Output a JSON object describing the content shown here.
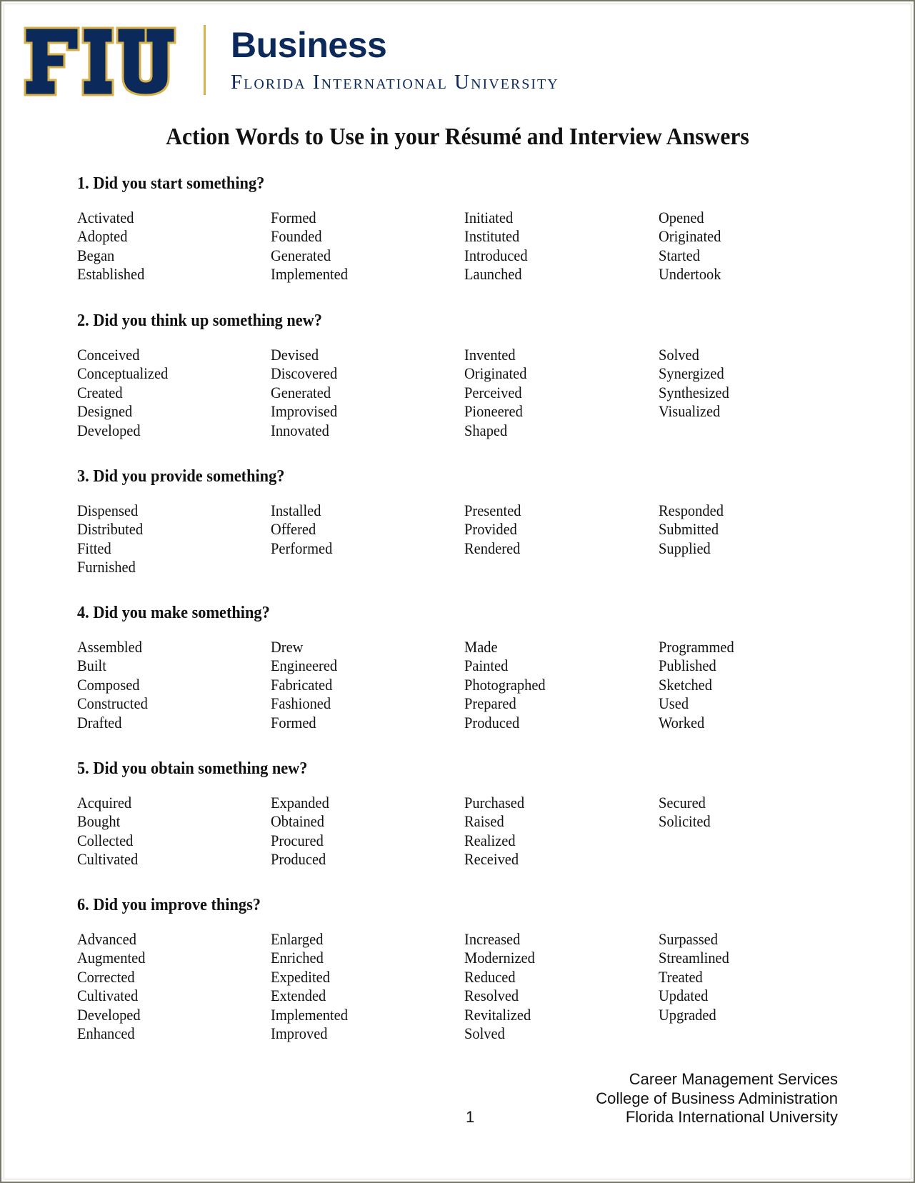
{
  "header": {
    "logo_text": "FIU",
    "business": "Business",
    "university": "Florida International University",
    "colors": {
      "navy": "#0b2a5b",
      "gold": "#d8b14a"
    }
  },
  "title": "Action Words to Use in your Résumé and Interview Answers",
  "sections": [
    {
      "heading": "1. Did you start something?",
      "columns": [
        [
          "Activated",
          "Adopted",
          "Began",
          "Established"
        ],
        [
          "Formed",
          "Founded",
          "Generated",
          "Implemented"
        ],
        [
          "Initiated",
          "Instituted",
          "Introduced",
          "Launched"
        ],
        [
          "Opened",
          "Originated",
          "Started",
          "Undertook"
        ]
      ]
    },
    {
      "heading": "2. Did you think up something new?",
      "columns": [
        [
          "Conceived",
          "Conceptualized",
          "Created",
          "Designed",
          "Developed"
        ],
        [
          "Devised",
          "Discovered",
          "Generated",
          "Improvised",
          "Innovated"
        ],
        [
          "Invented",
          "Originated",
          "Perceived",
          "Pioneered",
          "Shaped"
        ],
        [
          "Solved",
          "Synergized",
          "Synthesized",
          "Visualized"
        ]
      ]
    },
    {
      "heading": "3. Did you provide something?",
      "columns": [
        [
          "Dispensed",
          "Distributed",
          "Fitted",
          "Furnished"
        ],
        [
          "Installed",
          "Offered",
          "Performed"
        ],
        [
          "Presented",
          "Provided",
          "Rendered"
        ],
        [
          "Responded",
          "Submitted",
          "Supplied"
        ]
      ]
    },
    {
      "heading": "4. Did you make something?",
      "columns": [
        [
          "Assembled",
          "Built",
          "Composed",
          "Constructed",
          "Drafted"
        ],
        [
          "Drew",
          "Engineered",
          "Fabricated",
          "Fashioned",
          "Formed"
        ],
        [
          "Made",
          "Painted",
          "Photographed",
          "Prepared",
          "Produced"
        ],
        [
          "Programmed",
          "Published",
          "Sketched",
          "Used",
          "Worked"
        ]
      ]
    },
    {
      "heading": "5. Did you obtain something new?",
      "columns": [
        [
          "Acquired",
          "Bought",
          "Collected",
          "Cultivated"
        ],
        [
          "Expanded",
          "Obtained",
          "Procured",
          "Produced"
        ],
        [
          "Purchased",
          "Raised",
          "Realized",
          "Received"
        ],
        [
          "Secured",
          "Solicited"
        ]
      ]
    },
    {
      "heading": "6. Did you improve things?",
      "columns": [
        [
          "Advanced",
          "Augmented",
          "Corrected",
          "Cultivated",
          "Developed",
          "Enhanced"
        ],
        [
          "Enlarged",
          "Enriched",
          "Expedited",
          "Extended",
          "Implemented",
          "Improved"
        ],
        [
          "Increased",
          "Modernized",
          "Reduced",
          "Resolved",
          "Revitalized",
          "Solved"
        ],
        [
          "Surpassed",
          "Streamlined",
          "Treated",
          "Updated",
          "Upgraded"
        ]
      ]
    }
  ],
  "footer": {
    "page_number": "1",
    "lines": [
      "Career Management Services",
      "College of Business Administration",
      "Florida International University"
    ]
  }
}
